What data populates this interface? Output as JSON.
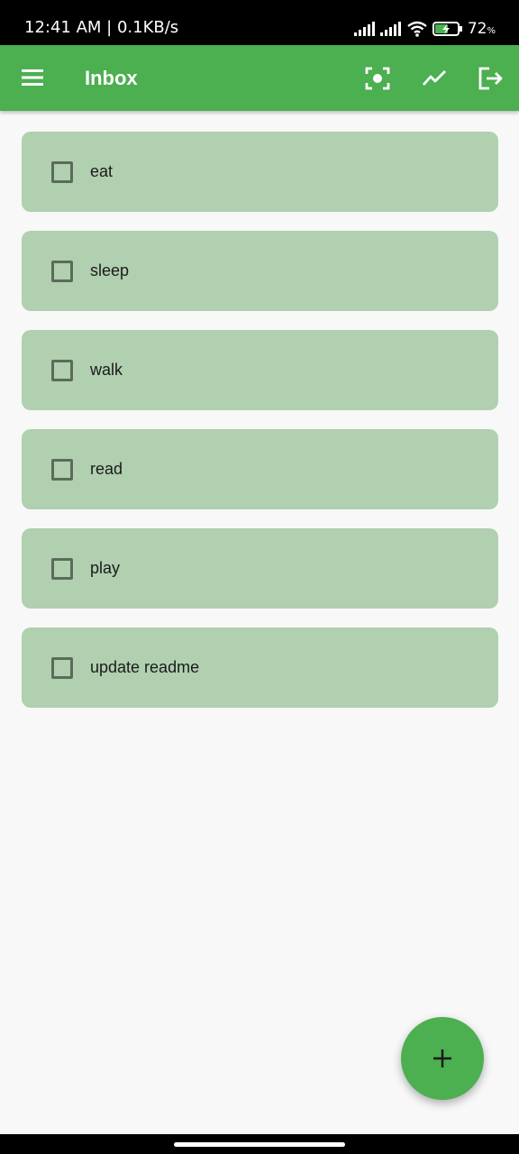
{
  "status_bar": {
    "time_speed": "12:41 AM | 0.1KB/s",
    "battery": "72",
    "battery_unit": "%"
  },
  "app_bar": {
    "title": "Inbox",
    "icons": [
      "menu-icon",
      "focus-icon",
      "trending-icon",
      "logout-icon"
    ]
  },
  "tasks": [
    {
      "label": "eat",
      "checked": false
    },
    {
      "label": "sleep",
      "checked": false
    },
    {
      "label": "walk",
      "checked": false
    },
    {
      "label": "read",
      "checked": false
    },
    {
      "label": "play",
      "checked": false
    },
    {
      "label": "update readme",
      "checked": false
    }
  ],
  "fab": {
    "icon": "plus-icon"
  },
  "colors": {
    "primary": "#4caf50",
    "card": "#b0d0b0",
    "background": "#f8f8f8"
  }
}
